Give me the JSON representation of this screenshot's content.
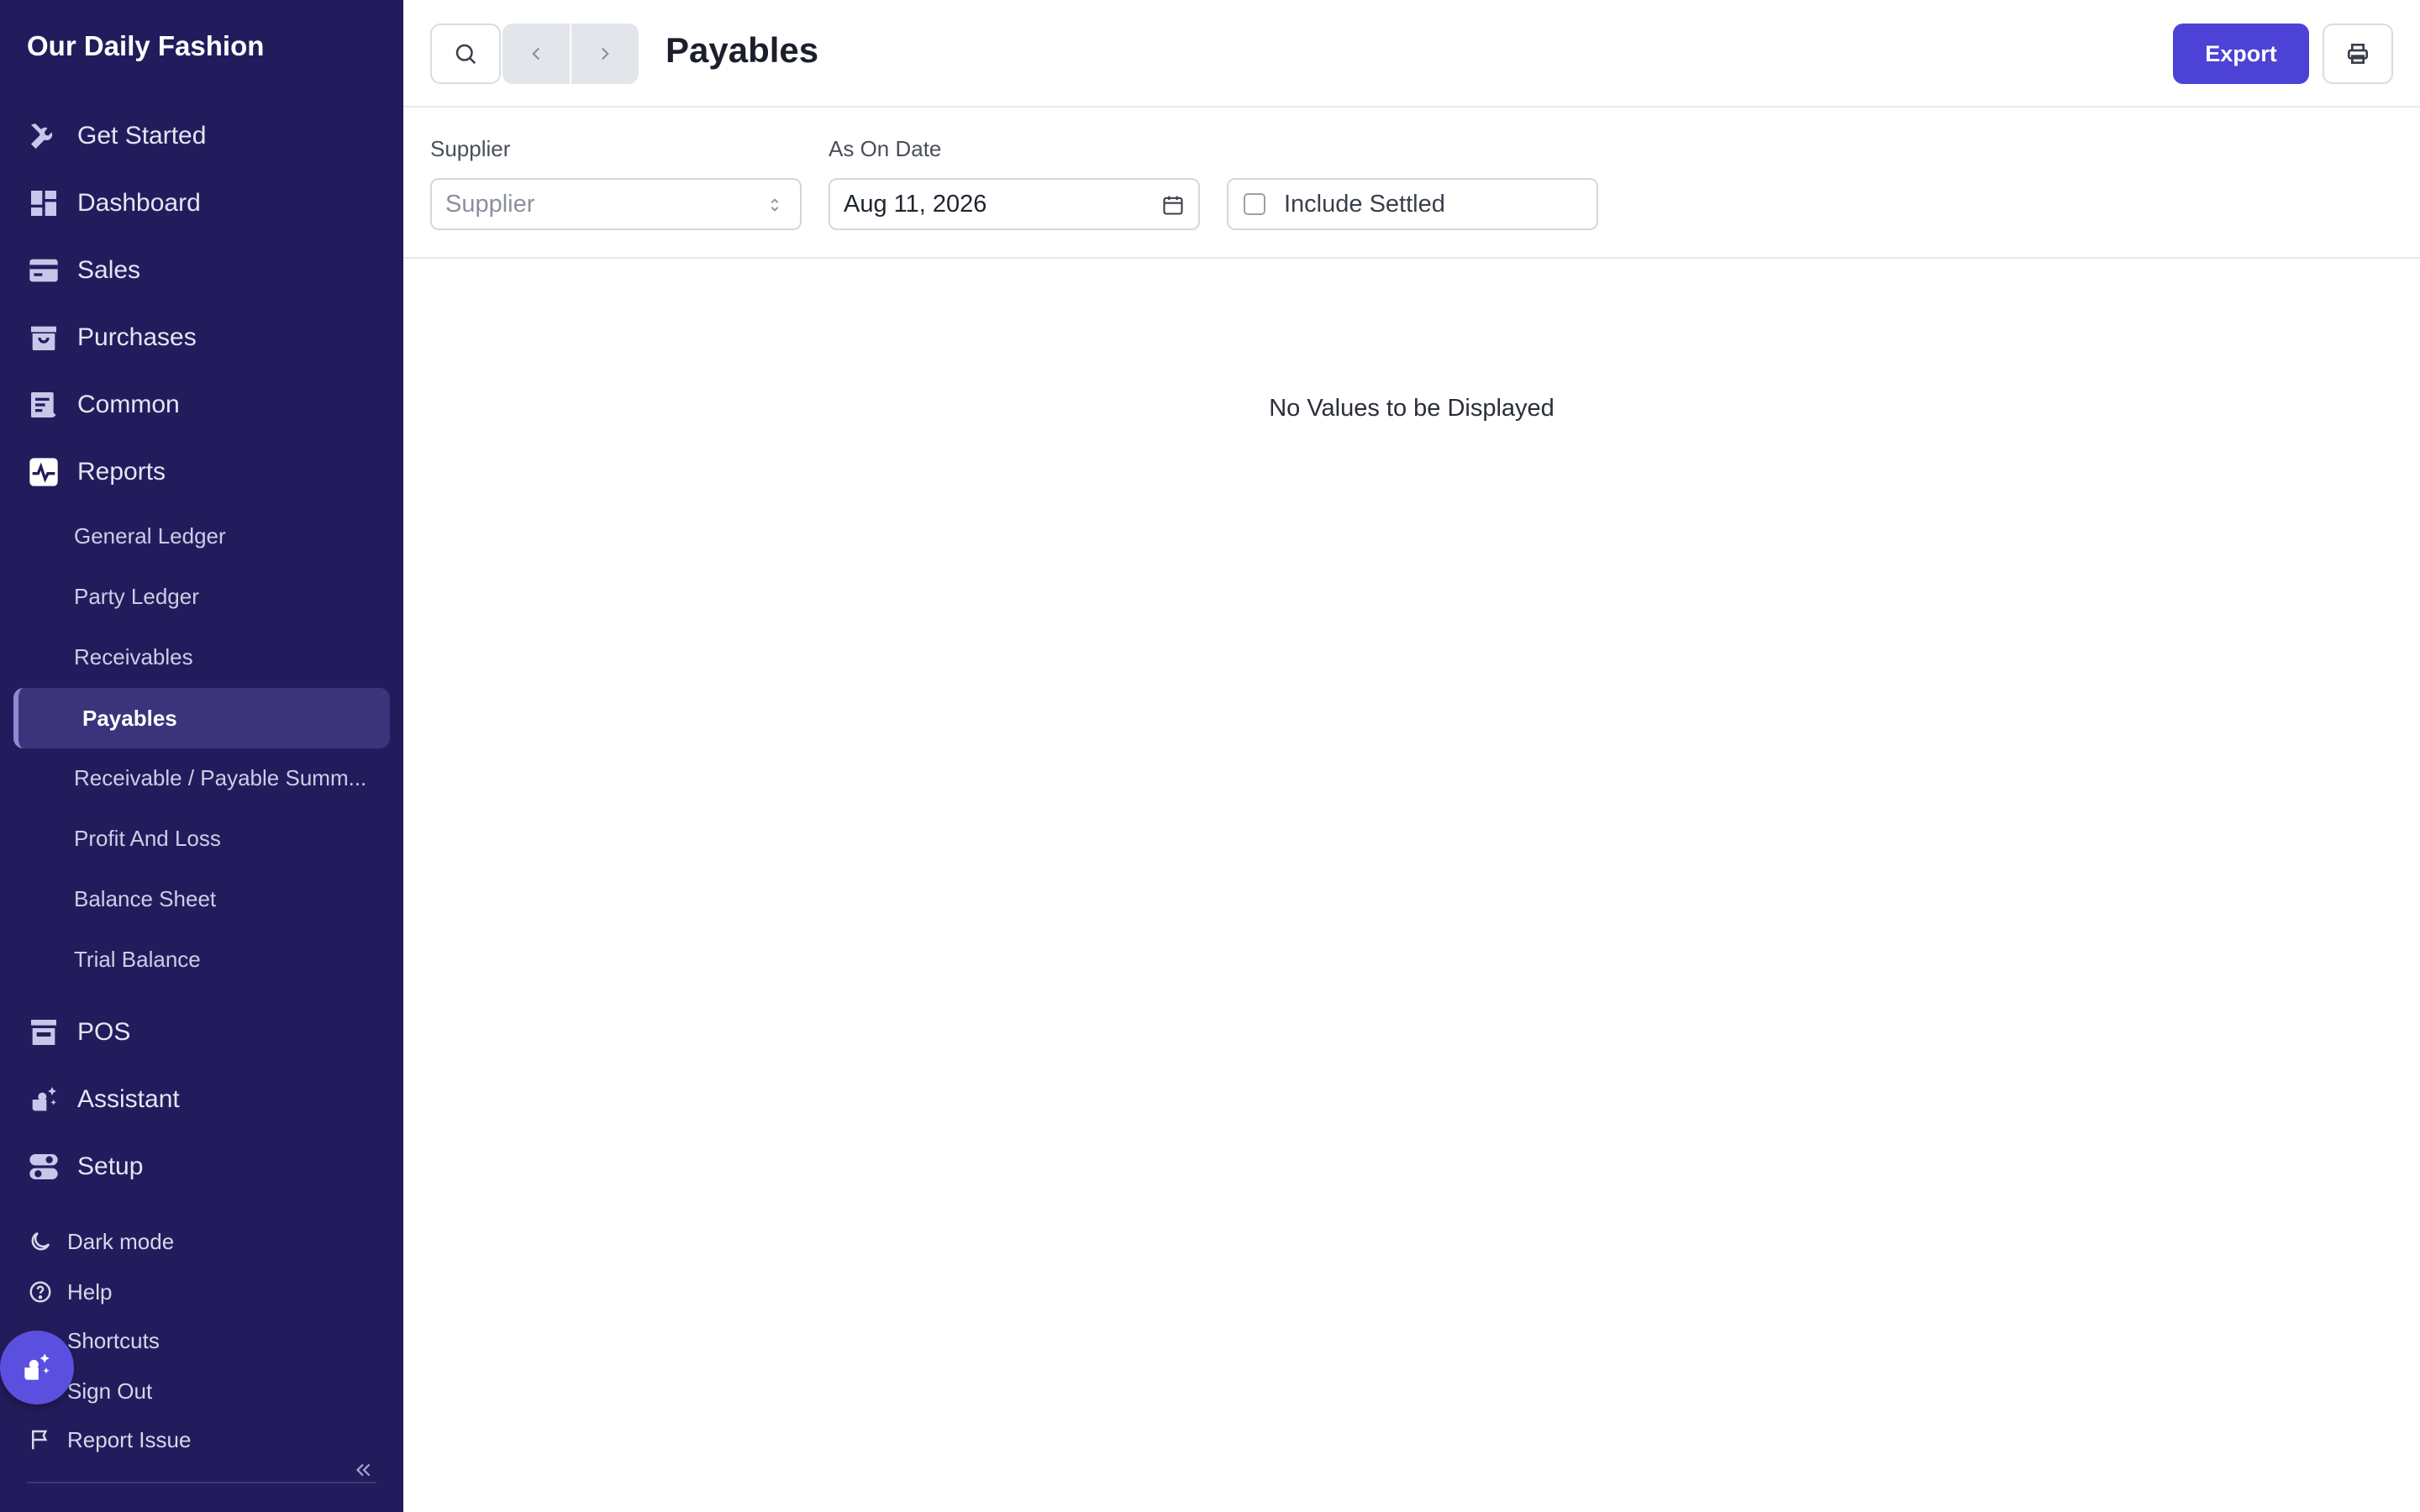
{
  "sidebar": {
    "company": "Our Daily Fashion",
    "nav": [
      {
        "label": "Get Started",
        "icon": "tools-icon"
      },
      {
        "label": "Dashboard",
        "icon": "dashboard-icon"
      },
      {
        "label": "Sales",
        "icon": "sales-icon"
      },
      {
        "label": "Purchases",
        "icon": "purchases-icon"
      },
      {
        "label": "Common",
        "icon": "common-icon"
      },
      {
        "label": "Reports",
        "icon": "reports-icon"
      }
    ],
    "reports_sub": [
      "General Ledger",
      "Party Ledger",
      "Receivables",
      "Payables",
      "Receivable / Payable Summ...",
      "Profit And Loss",
      "Balance Sheet",
      "Trial Balance"
    ],
    "active_sub": "Payables",
    "nav_after": [
      {
        "label": "POS",
        "icon": "pos-icon"
      },
      {
        "label": "Assistant",
        "icon": "assistant-icon"
      },
      {
        "label": "Setup",
        "icon": "setup-icon"
      }
    ],
    "footer": [
      {
        "label": "Dark mode",
        "icon": "moon-icon"
      },
      {
        "label": "Help",
        "icon": "help-icon"
      },
      {
        "label": "Shortcuts",
        "icon": "shortcuts-icon"
      },
      {
        "label": "Sign Out",
        "icon": "sign-out-icon"
      },
      {
        "label": "Report Issue",
        "icon": "flag-icon"
      }
    ]
  },
  "header": {
    "title": "Payables",
    "export_label": "Export"
  },
  "filters": {
    "supplier_label": "Supplier",
    "supplier_placeholder": "Supplier",
    "date_label": "As On Date",
    "date_value": "Aug 11, 2026",
    "include_settled_label": "Include Settled",
    "include_settled_checked": false
  },
  "content": {
    "empty_message": "No Values to be Displayed"
  },
  "colors": {
    "sidebar_bg": "#231c5c",
    "accent": "#4d42d6",
    "active_item_bg": "#3b347a"
  }
}
